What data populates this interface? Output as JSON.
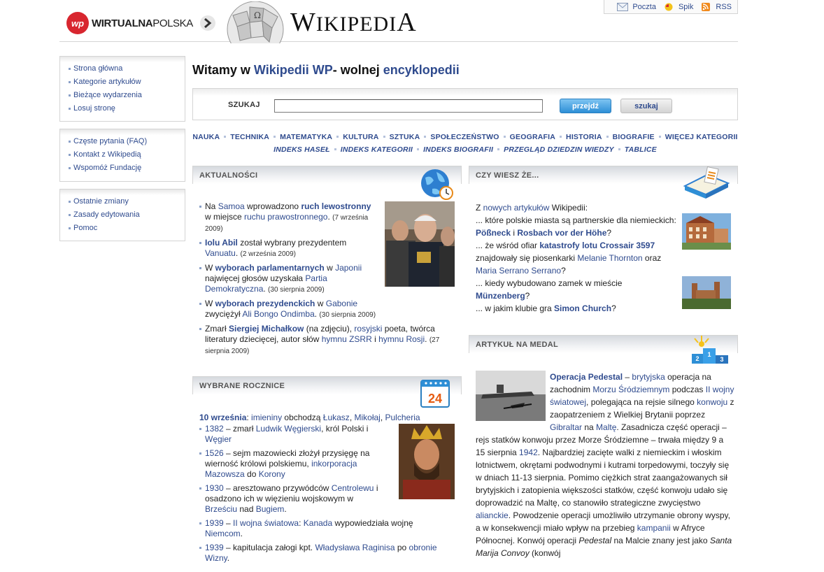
{
  "header": {
    "portal_name_bold": "WIRTUALNA",
    "portal_name_rest": "POLSKA",
    "wiki_title_big": "W",
    "wiki_title_rest": "IKIPEDI",
    "wiki_title_last": "A",
    "toplinks": [
      {
        "label": "Poczta",
        "icon": "mail-icon"
      },
      {
        "label": "Spik",
        "icon": "chat-icon"
      },
      {
        "label": "RSS",
        "icon": "rss-icon"
      }
    ]
  },
  "menu": {
    "group1": [
      "Strona główna",
      "Kategorie artykułów",
      "Bieżące wydarzenia",
      "Losuj stronę"
    ],
    "group2": [
      "Częste pytania (FAQ)",
      "Kontakt z Wikipedią",
      "Wspomóż Fundację"
    ],
    "group3": [
      "Ostatnie zmiany",
      "Zasady edytowania",
      "Pomoc"
    ]
  },
  "welcome": {
    "t1": "Witamy w ",
    "t2": "Wikipedii WP",
    "t3": "- wolnej ",
    "t4": "encyklopedii"
  },
  "search": {
    "label": "SZUKAJ",
    "value": "",
    "go_label": "przejdź",
    "search_label": "szukaj"
  },
  "categories": {
    "row1": [
      "NAUKA",
      "TECHNIKA",
      "MATEMATYKA",
      "KULTURA",
      "SZTUKA",
      "SPOŁECZEŃSTWO",
      "GEOGRAFIA",
      "HISTORIA",
      "BIOGRAFIE",
      "WIĘCEJ KATEGORII"
    ],
    "row2": [
      "INDEKS HASEŁ",
      "INDEKS KATEGORII",
      "INDEKS BIOGRAFII",
      "PRZEGLĄD DZIEDZIN WIEDZY",
      "TABLICE"
    ]
  },
  "panels": {
    "news": "AKTUALNOŚCI",
    "dyk": "CZY WIESZ ŻE...",
    "anniv": "WYBRANE ROCZNICE",
    "medal": "ARTYKUŁ NA MEDAL"
  },
  "news": [
    {
      "a": "Na ",
      "b": "Samoa",
      "c": " wprowadzono ",
      "d": "ruch lewostronny",
      "e": " w miejsce ",
      "f": "ruchu prawostronnego",
      "g": ". ",
      "date": "(7 września 2009)"
    },
    {
      "a": "Iolu Abil",
      "b": " został wybrany prezydentem ",
      "c": "Vanuatu",
      "d": ". ",
      "date": "(2 września 2009)"
    },
    {
      "a": "W ",
      "b": "wyborach parlamentarnych",
      "c": " w ",
      "d": "Japonii",
      "e": " najwięcej głosów uzyskała ",
      "f": "Partia Demokratyczna",
      "g": ". ",
      "date": "(30 sierpnia 2009)"
    },
    {
      "a": "W ",
      "b": "wyborach prezydenckich",
      "c": " w ",
      "d": "Gabonie",
      "e": " zwyciężył ",
      "f": "Ali Bongo Ondimba",
      "g": ". ",
      "date": "(30 sierpnia 2009)"
    },
    {
      "a": "Zmarł ",
      "b": "Siergiej Michałkow",
      "c": " (na zdjęciu), ",
      "d": "rosyjski",
      "e": " poeta, twórca literatury dziecięcej, autor słów ",
      "f": "hymnu ZSRR",
      "g": " i ",
      "h": "hymnu Rosji",
      "i": ". ",
      "date": "(27 sierpnia 2009)"
    }
  ],
  "anniv": {
    "head_date": "10 września",
    "head_sep": ": ",
    "head_imieniny": "imieniny",
    "head_rest": " obchodzą ",
    "names": [
      "Łukasz",
      "Mikołaj",
      "Pulcheria"
    ],
    "calendar_day": "24",
    "items": [
      {
        "year": "1382",
        "a": " – zmarł ",
        "b": "Ludwik Węgierski",
        "c": ", król Polski i ",
        "d": "Węgier"
      },
      {
        "year": "1526",
        "a": " – sejm mazowiecki złożył przysięgę na wierność królowi polskiemu, ",
        "b": "inkorporacja Mazowsza",
        "c": " do ",
        "d": "Korony"
      },
      {
        "year": "1930",
        "a": " – aresztowano przywódców ",
        "b": "Centrolewu",
        "c": " i osadzono ich w więzieniu wojskowym w ",
        "d": "Brześciu",
        "e": " nad ",
        "f": "Bugiem",
        "g": "."
      },
      {
        "year": "1939",
        "a": " – ",
        "b": "II wojna światowa",
        "c": ": ",
        "d": "Kanada",
        "e": " wypowiedziała wojnę ",
        "f": "Niemcom",
        "g": "."
      },
      {
        "year": "1939",
        "a": " – kapitulacja załogi kpt. ",
        "b": "Władysława Raginisa",
        "c": " po ",
        "d": "obronie Wizny",
        "e": "."
      }
    ]
  },
  "dyk": {
    "intro_a": "Z ",
    "intro_b": "nowych artykułów",
    "intro_c": " Wikipedii:",
    "q1_a": "... które polskie miasta są partnerskie dla niemieckich: ",
    "q1_b": "Pößneck",
    "q1_c": " i ",
    "q1_d": "Rosbach vor der Höhe",
    "q1_e": "?",
    "q2_a": "... że wśród ofiar ",
    "q2_b": "katastrofy lotu Crossair 3597",
    "q2_c": " znajdowały się piosenkarki ",
    "q2_d": "Melanie Thornton",
    "q2_e": " oraz ",
    "q2_f": "Maria Serrano Serrano",
    "q2_g": "?",
    "q3_a": "... kiedy wybudowano zamek w mieście ",
    "q3_b": "Münzenberg",
    "q3_c": "?",
    "q4_a": "... w jakim klubie gra ",
    "q4_b": "Simon Church",
    "q4_c": "?"
  },
  "medal": {
    "title": "Operacja Pedestal",
    "t1": " – ",
    "l1": "brytyjska",
    "t2": " operacja na zachodnim ",
    "l2": "Morzu Śródziemnym",
    "t3": " podczas ",
    "l3": "II wojny światowej",
    "t4": ", polegająca na rejsie silnego ",
    "l4": "konwoju",
    "t5": " z zaopatrzeniem z Wielkiej Brytanii poprzez ",
    "l5": "Gibraltar",
    "t6": " na ",
    "l6": "Maltę",
    "t7": ". Zasadnicza część operacji – rejs statków konwoju przez Morze Śródziemne – trwała między 9 a 15 sierpnia ",
    "l7": "1942",
    "t8": ". Najbardziej zacięte walki z niemieckim i włoskim lotnictwem, okrętami podwodnymi i kutrami torpedowymi, toczyły się w dniach 11-13 sierpnia. Pomimo ciężkich strat zaangażowanych sił brytyjskich i zatopienia większości statków, część konwoju udało się doprowadzić na Maltę, co stanowiło strategiczne zwycięstwo ",
    "l8": "alianckie",
    "t9": ". Powodzenie operacji umożliwiło utrzymanie obrony wyspy, a w konsekwencji miało wpływ na przebieg ",
    "l9": "kampanii",
    "t10": " w Afryce Północnej. Konwój operacji ",
    "i1": "Pedestal",
    "t11": " na Malcie znany jest jako ",
    "i2": "Santa Marija Convoy",
    "t12": " (konwój"
  },
  "colors": {
    "link": "#2f4b8e",
    "wp_red": "#d8262f",
    "button_blue": "#2e8fd6"
  }
}
